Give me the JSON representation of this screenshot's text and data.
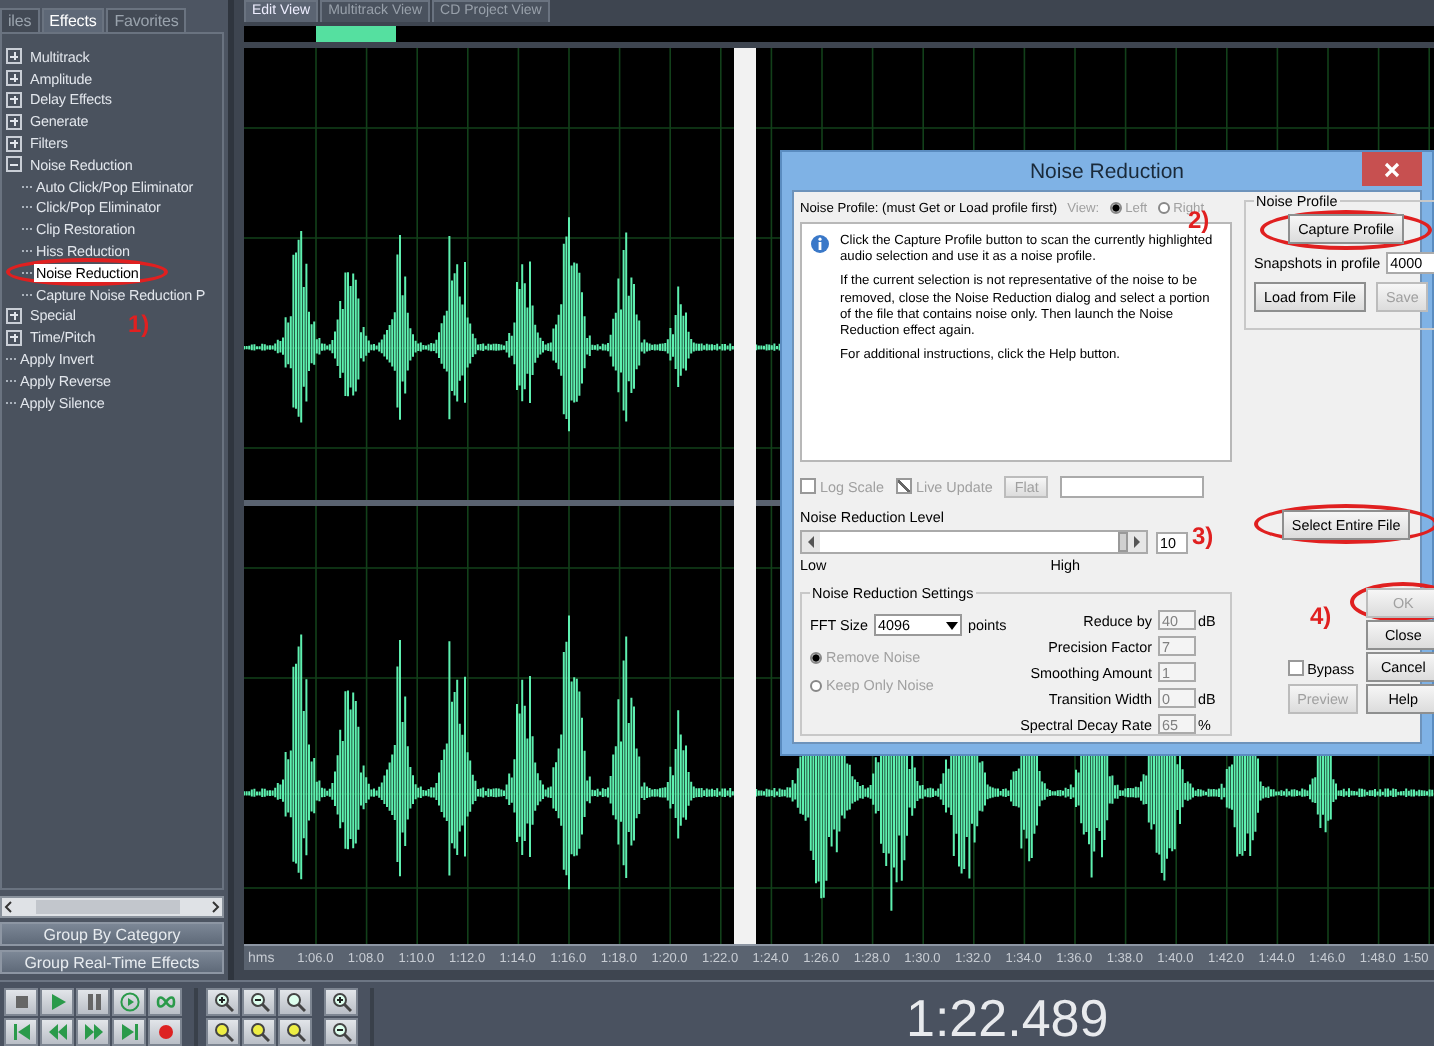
{
  "left_panel": {
    "tabs": [
      {
        "label": "iles",
        "selected": false
      },
      {
        "label": "Effects",
        "selected": true
      },
      {
        "label": "Favorites",
        "selected": false
      }
    ],
    "tree": [
      {
        "kind": "folder",
        "label": "Multitrack",
        "expanded": false,
        "selected": false
      },
      {
        "kind": "folder",
        "label": "Amplitude",
        "expanded": false,
        "selected": false
      },
      {
        "kind": "folder",
        "label": "Delay Effects",
        "expanded": false,
        "selected": false
      },
      {
        "kind": "folder",
        "label": "Generate",
        "expanded": false,
        "selected": false
      },
      {
        "kind": "folder",
        "label": "Filters",
        "expanded": false,
        "selected": false
      },
      {
        "kind": "folder",
        "label": "Noise Reduction",
        "expanded": true,
        "selected": false,
        "children": [
          {
            "kind": "effect",
            "label": "Auto Click/Pop Eliminator",
            "selected": false
          },
          {
            "kind": "effect",
            "label": "Click/Pop Eliminator",
            "selected": false
          },
          {
            "kind": "effect",
            "label": "Clip Restoration",
            "selected": false
          },
          {
            "kind": "effect",
            "label": "Hiss Reduction",
            "selected": false
          },
          {
            "kind": "effect",
            "label": "Noise Reduction",
            "selected": true
          },
          {
            "kind": "effect",
            "label": "Capture Noise Reduction P",
            "selected": false
          }
        ]
      },
      {
        "kind": "folder",
        "label": "Special",
        "expanded": false,
        "selected": false
      },
      {
        "kind": "folder",
        "label": "Time/Pitch",
        "expanded": false,
        "selected": false
      },
      {
        "kind": "effect",
        "label": "Apply Invert",
        "selected": false
      },
      {
        "kind": "effect",
        "label": "Apply Reverse",
        "selected": false
      },
      {
        "kind": "effect",
        "label": "Apply Silence",
        "selected": false
      }
    ],
    "buttons": [
      "Group By Category",
      "Group Real-Time Effects"
    ]
  },
  "editor": {
    "view_tabs": [
      {
        "label": "Edit View",
        "selected": true
      },
      {
        "label": "Multitrack View",
        "selected": false
      },
      {
        "label": "CD Project View",
        "selected": false
      }
    ],
    "ruler": {
      "unit": "hms",
      "ticks": [
        "1:06.0",
        "1:08.0",
        "1:10.0",
        "1:12.0",
        "1:14.0",
        "1:16.0",
        "1:18.0",
        "1:20.0",
        "1:22.0",
        "1:24.0",
        "1:26.0",
        "1:28.0",
        "1:30.0",
        "1:32.0",
        "1:34.0",
        "1:36.0",
        "1:38.0",
        "1:40.0",
        "1:42.0",
        "1:44.0",
        "1:46.0",
        "1:48.0",
        "1:50"
      ]
    }
  },
  "time_display": "1:22.489",
  "dialog": {
    "title": "Noise Reduction",
    "profile_hint": "Noise Profile: (must Get or Load profile first)",
    "view_label": "View:",
    "view_options": [
      {
        "label": "Left",
        "selected": true,
        "disabled": true
      },
      {
        "label": "Right",
        "selected": false,
        "disabled": true
      }
    ],
    "info_paragraphs": [
      "Click the Capture Profile button to scan the currently highlighted audio selection and use it as a noise profile.",
      "If the current selection is not representative of the noise to be removed, close the Noise Reduction dialog and select a portion of the file that contains noise only.  Then launch the Noise Reduction effect again.",
      "For additional instructions, click the Help button."
    ],
    "graph_options": [
      {
        "kind": "checkbox",
        "label": "Log Scale",
        "checked": false,
        "disabled": true
      },
      {
        "kind": "checkbox",
        "label": "Live Update",
        "checked": true,
        "disabled": true
      },
      {
        "kind": "button",
        "label": "Flat",
        "disabled": true
      }
    ],
    "profile_group": {
      "legend": "Noise Profile",
      "capture_button": "Capture Profile",
      "snapshots_label": "Snapshots in profile",
      "snapshots_value": "4000",
      "load_button": "Load from File",
      "save_button": {
        "label": "Save",
        "disabled": true
      }
    },
    "reduction_level": {
      "label": "Noise Reduction Level",
      "level": 1,
      "value": "10",
      "low": "Low",
      "high": "High"
    },
    "select_button": "Select Entire File",
    "settings": {
      "legend": "Noise Reduction Settings",
      "fft_label": "FFT Size",
      "fft_value": "4096",
      "fft_unit": "points",
      "modes": [
        {
          "label": "Remove Noise",
          "selected": true,
          "disabled": true
        },
        {
          "label": "Keep Only Noise",
          "selected": false,
          "disabled": true
        }
      ],
      "params": [
        {
          "label": "Reduce by",
          "value": "40",
          "unit": "dB",
          "disabled": true
        },
        {
          "label": "Precision Factor",
          "value": "7",
          "disabled": true
        },
        {
          "label": "Smoothing Amount",
          "value": "1",
          "disabled": true
        },
        {
          "label": "Transition Width",
          "value": "0",
          "unit": "dB",
          "disabled": true
        },
        {
          "label": "Spectral Decay Rate",
          "value": "65",
          "unit": "%",
          "disabled": true
        }
      ]
    },
    "bypass": {
      "label": "Bypass",
      "checked": false
    },
    "preview_button": {
      "label": "Preview",
      "disabled": true
    },
    "buttons": [
      {
        "label": "OK",
        "disabled": true
      },
      {
        "label": "Close",
        "disabled": false
      },
      {
        "label": "Cancel",
        "disabled": false
      },
      {
        "label": "Help",
        "disabled": false
      }
    ]
  },
  "annotations": [
    {
      "label": "1)"
    },
    {
      "label": "2)"
    },
    {
      "label": "3)"
    },
    {
      "label": "4)"
    }
  ]
}
